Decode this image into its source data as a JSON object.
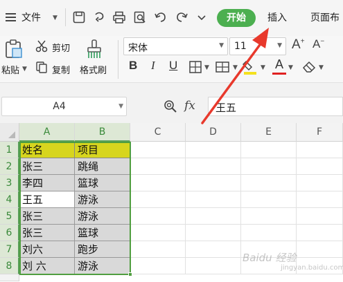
{
  "menubar": {
    "file_label": "文件",
    "tabs": [
      {
        "label": "开始",
        "active": true
      },
      {
        "label": "插入"
      },
      {
        "label": "页面布"
      }
    ]
  },
  "ribbon": {
    "paste_label": "粘贴",
    "cut_label": "剪切",
    "copy_label": "复制",
    "format_painter_label": "格式刷",
    "font_name": "宋体",
    "font_size": "11",
    "bold": "B",
    "italic": "I",
    "underline": "U",
    "font_color_letter": "A",
    "grow_font": "A",
    "shrink_font": "A"
  },
  "formula_bar": {
    "cell_ref": "A4",
    "fx_label": "fx",
    "value": "王五"
  },
  "sheet": {
    "columns": [
      "A",
      "B",
      "C",
      "D",
      "E",
      "F"
    ],
    "rows": [
      "1",
      "2",
      "3",
      "4",
      "5",
      "6",
      "7",
      "8"
    ],
    "cells": [
      [
        "姓名",
        "项目"
      ],
      [
        "张三",
        "跳绳"
      ],
      [
        "李四",
        "篮球"
      ],
      [
        "王五",
        "游泳"
      ],
      [
        "张三",
        "游泳"
      ],
      [
        "张三",
        "篮球"
      ],
      [
        "刘六",
        "跑步"
      ],
      [
        "刘 六",
        "游泳"
      ]
    ]
  },
  "colors": {
    "accent": "#4caf50",
    "header_fill": "#d7d51e",
    "data_fill": "#d9d9d9",
    "selection": "#4f9e3f",
    "arrow": "#e8392c"
  },
  "icons": [
    "hamburger-icon",
    "save-icon",
    "undo-history-icon",
    "print-icon",
    "print-preview-icon",
    "undo-icon",
    "redo-icon",
    "dropdown-icon",
    "paste-icon",
    "cut-icon",
    "copy-icon",
    "format-painter-icon",
    "border-icon",
    "cell-fill-icon",
    "highlight-icon",
    "eraser-icon",
    "zoom-icon"
  ],
  "watermark": {
    "main": "Baidu 经验",
    "sub": "jingyan.baidu.com"
  }
}
